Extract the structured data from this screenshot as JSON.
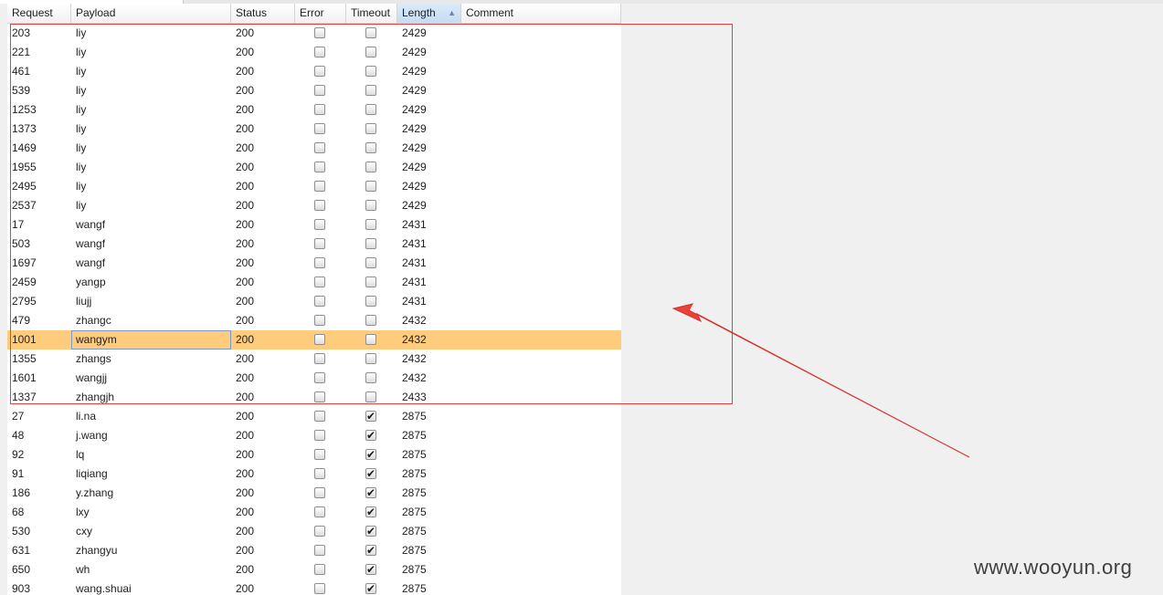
{
  "columns": [
    {
      "key": "request",
      "label": "Request"
    },
    {
      "key": "payload",
      "label": "Payload"
    },
    {
      "key": "status",
      "label": "Status"
    },
    {
      "key": "error",
      "label": "Error"
    },
    {
      "key": "timeout",
      "label": "Timeout"
    },
    {
      "key": "length",
      "label": "Length",
      "sort": "ascending"
    },
    {
      "key": "comment",
      "label": "Comment"
    }
  ],
  "sort_indicator": "▲",
  "rows": [
    {
      "request": "203",
      "payload": "liy",
      "status": "200",
      "error": false,
      "timeout": false,
      "length": "2429"
    },
    {
      "request": "221",
      "payload": "liy",
      "status": "200",
      "error": false,
      "timeout": false,
      "length": "2429"
    },
    {
      "request": "461",
      "payload": "liy",
      "status": "200",
      "error": false,
      "timeout": false,
      "length": "2429"
    },
    {
      "request": "539",
      "payload": "liy",
      "status": "200",
      "error": false,
      "timeout": false,
      "length": "2429"
    },
    {
      "request": "1253",
      "payload": "liy",
      "status": "200",
      "error": false,
      "timeout": false,
      "length": "2429"
    },
    {
      "request": "1373",
      "payload": "liy",
      "status": "200",
      "error": false,
      "timeout": false,
      "length": "2429"
    },
    {
      "request": "1469",
      "payload": "liy",
      "status": "200",
      "error": false,
      "timeout": false,
      "length": "2429"
    },
    {
      "request": "1955",
      "payload": "liy",
      "status": "200",
      "error": false,
      "timeout": false,
      "length": "2429"
    },
    {
      "request": "2495",
      "payload": "liy",
      "status": "200",
      "error": false,
      "timeout": false,
      "length": "2429"
    },
    {
      "request": "2537",
      "payload": "liy",
      "status": "200",
      "error": false,
      "timeout": false,
      "length": "2429"
    },
    {
      "request": "17",
      "payload": "wangf",
      "status": "200",
      "error": false,
      "timeout": false,
      "length": "2431"
    },
    {
      "request": "503",
      "payload": "wangf",
      "status": "200",
      "error": false,
      "timeout": false,
      "length": "2431"
    },
    {
      "request": "1697",
      "payload": "wangf",
      "status": "200",
      "error": false,
      "timeout": false,
      "length": "2431"
    },
    {
      "request": "2459",
      "payload": "yangp",
      "status": "200",
      "error": false,
      "timeout": false,
      "length": "2431"
    },
    {
      "request": "2795",
      "payload": "liujj",
      "status": "200",
      "error": false,
      "timeout": false,
      "length": "2431"
    },
    {
      "request": "479",
      "payload": "zhangc",
      "status": "200",
      "error": false,
      "timeout": false,
      "length": "2432"
    },
    {
      "request": "1001",
      "payload": "wangym",
      "status": "200",
      "error": false,
      "timeout": false,
      "length": "2432",
      "selected": true
    },
    {
      "request": "1355",
      "payload": "zhangs",
      "status": "200",
      "error": false,
      "timeout": false,
      "length": "2432"
    },
    {
      "request": "1601",
      "payload": "wangjj",
      "status": "200",
      "error": false,
      "timeout": false,
      "length": "2432"
    },
    {
      "request": "1337",
      "payload": "zhangjh",
      "status": "200",
      "error": false,
      "timeout": false,
      "length": "2433"
    },
    {
      "request": "27",
      "payload": "li.na",
      "status": "200",
      "error": false,
      "timeout": true,
      "length": "2875"
    },
    {
      "request": "48",
      "payload": "j.wang",
      "status": "200",
      "error": false,
      "timeout": true,
      "length": "2875"
    },
    {
      "request": "92",
      "payload": "lq",
      "status": "200",
      "error": false,
      "timeout": true,
      "length": "2875"
    },
    {
      "request": "91",
      "payload": "liqiang",
      "status": "200",
      "error": false,
      "timeout": true,
      "length": "2875"
    },
    {
      "request": "186",
      "payload": "y.zhang",
      "status": "200",
      "error": false,
      "timeout": true,
      "length": "2875"
    },
    {
      "request": "68",
      "payload": "lxy",
      "status": "200",
      "error": false,
      "timeout": true,
      "length": "2875"
    },
    {
      "request": "530",
      "payload": "cxy",
      "status": "200",
      "error": false,
      "timeout": true,
      "length": "2875"
    },
    {
      "request": "631",
      "payload": "zhangyu",
      "status": "200",
      "error": false,
      "timeout": true,
      "length": "2875"
    },
    {
      "request": "650",
      "payload": "wh",
      "status": "200",
      "error": false,
      "timeout": true,
      "length": "2875"
    },
    {
      "request": "903",
      "payload": "wang.shuai",
      "status": "200",
      "error": false,
      "timeout": true,
      "length": "2875"
    }
  ],
  "checkmark_glyph": "✔",
  "colors": {
    "selected_row": "#ffcb7c",
    "annotation_red": "#e04040",
    "sorted_header": "#c4dcf3"
  },
  "watermark": "www.wooyun.org"
}
